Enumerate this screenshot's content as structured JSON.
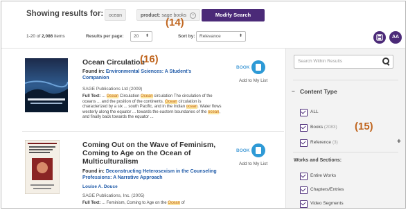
{
  "header": {
    "showing_label": "Showing results for:",
    "query_chip": "ocean",
    "product_label": "product:",
    "product_value": "sage books",
    "modify_button": "Modify Search",
    "count_range": "1-20",
    "count_of": "of",
    "count_total": "2,086",
    "count_unit": "items",
    "per_page_label": "Results per page:",
    "per_page_value": "20",
    "sort_label": "Sort by:",
    "sort_value": "Relevance",
    "save_icon": "save-icon",
    "text_size_label": "AA"
  },
  "annotations": {
    "a14": "(14)",
    "a15": "(15)",
    "a16": "(16)"
  },
  "results": [
    {
      "title": "Ocean Circulation",
      "found_label": "Found in:",
      "found_link": "Environmental Sciences: A Student's Companion",
      "publisher": "SAGE Publications Ltd (2009)",
      "fulltext_label": "Full Text:",
      "fulltext_parts": [
        "... ",
        "Ocean",
        " Circulation ",
        "Ocean",
        " circulation The circulation of the oceans ... and the position of the continents. ",
        "Ocean",
        " circulation is characterized by a six ... south Pacific, and in the Indian ",
        "ocean",
        ". Water flows westerly along the equator ... towards the eastern boundaries of the ",
        "ocean",
        ", and finally back towards the equator ..."
      ],
      "format": "BOOK",
      "add_list": "Add to My List"
    },
    {
      "title": "Coming Out on the Wave of Feminism, Coming to Age on the Ocean of Multiculturalism",
      "found_label": "Found in:",
      "found_link": "Deconstructing Heterosexism in the Counseling Professions: A Narrative Approach",
      "author": "Louise A. Douce",
      "publisher": "SAGE Publications, Inc. (2005)",
      "fulltext_label": "Full Text:",
      "fulltext_parts": [
        "... Feminism, Coming to Age on the ",
        "Ocean",
        " of"
      ],
      "format": "BOOK",
      "add_list": "Add to My List"
    }
  ],
  "sidebar": {
    "search_placeholder": "Search Within Results",
    "content_type_title": "Content Type",
    "content_types": [
      {
        "label": "ALL",
        "count": ""
      },
      {
        "label": "Books",
        "count": "(2083)"
      },
      {
        "label": "Reference",
        "count": "(3)"
      }
    ],
    "works_title": "Works and Sections:",
    "works": [
      {
        "label": "Entire Works"
      },
      {
        "label": "Chapters/Entries"
      },
      {
        "label": "Video Segments"
      }
    ]
  },
  "colors": {
    "brand_purple": "#4b2a78",
    "link_blue": "#1f5aa8",
    "book_blue": "#2e9ad6",
    "annotation_orange": "#c0651e",
    "highlight": "#fde7a0"
  }
}
